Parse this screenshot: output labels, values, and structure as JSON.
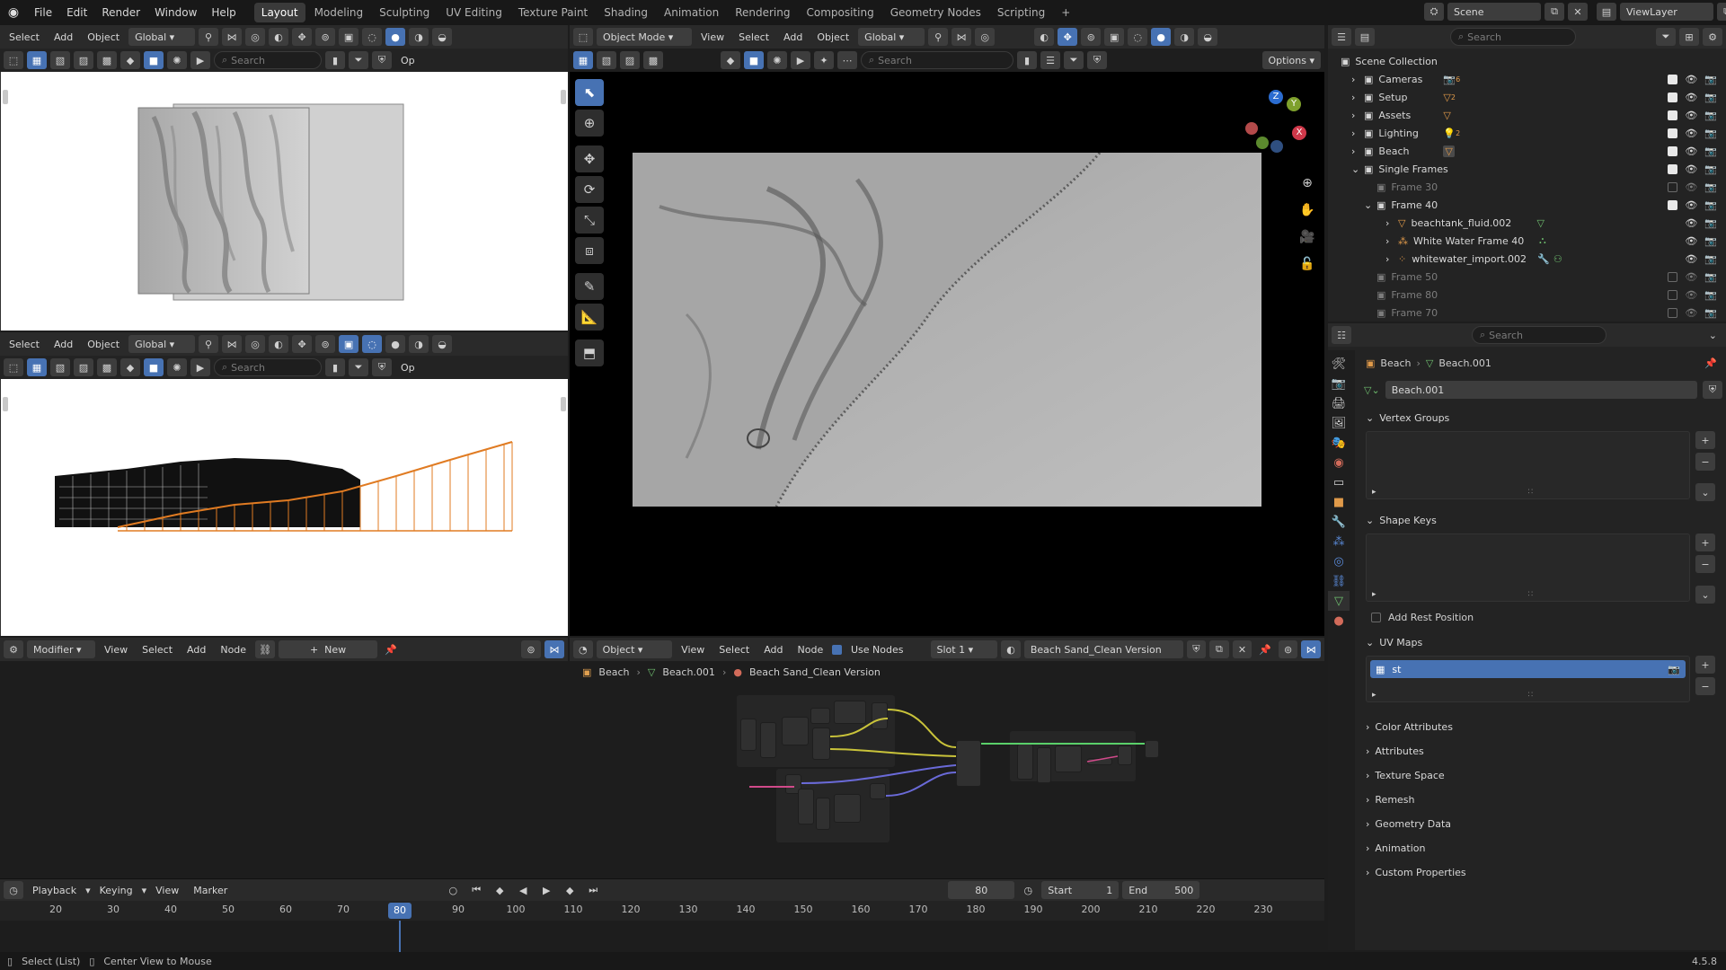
{
  "app": {
    "menus": [
      "File",
      "Edit",
      "Render",
      "Window",
      "Help"
    ],
    "workspaces": [
      "Layout",
      "Modeling",
      "Sculpting",
      "UV Editing",
      "Texture Paint",
      "Shading",
      "Animation",
      "Rendering",
      "Compositing",
      "Geometry Nodes",
      "Scripting"
    ],
    "active_workspace": "Layout",
    "scene_name": "Scene",
    "view_layer": "ViewLayer",
    "version": "4.5.8"
  },
  "viewports": {
    "left_header": {
      "select": "Select",
      "add": "Add",
      "object": "Object",
      "orientation": "Global",
      "search_placeholder": "Search",
      "options_short": "Op"
    },
    "main_header": {
      "mode": "Object Mode",
      "view": "View",
      "select": "Select",
      "add": "Add",
      "object": "Object",
      "orientation": "Global",
      "search_placeholder": "Search",
      "options": "Options"
    },
    "gizmo": {
      "z": "Z",
      "y": "Y",
      "x": "X"
    }
  },
  "modifier_editor": {
    "type": "Modifier",
    "menus": [
      "View",
      "Select",
      "Add",
      "Node"
    ],
    "new_label": "New"
  },
  "shader_editor": {
    "type": "Object",
    "menus": [
      "View",
      "Select",
      "Add",
      "Node"
    ],
    "use_nodes": "Use Nodes",
    "slot": "Slot 1",
    "material": "Beach Sand_Clean Version",
    "breadcrumb": [
      "Beach",
      "Beach.001",
      "Beach Sand_Clean Version"
    ]
  },
  "timeline": {
    "menus": [
      "Playback",
      "Keying",
      "View",
      "Marker"
    ],
    "current_frame": "80",
    "start_label": "Start",
    "start": "1",
    "end_label": "End",
    "end": "500",
    "ticks": [
      "20",
      "30",
      "40",
      "50",
      "60",
      "70",
      "80",
      "90",
      "100",
      "110",
      "120",
      "130",
      "140",
      "150",
      "160",
      "170",
      "180",
      "190",
      "200",
      "210",
      "220",
      "230"
    ]
  },
  "statusbar": {
    "left": "Select (List)",
    "middle": "Center View to Mouse"
  },
  "outliner": {
    "search_placeholder": "Search",
    "root": "Scene Collection",
    "items": [
      {
        "label": "Cameras",
        "badge": "6"
      },
      {
        "label": "Setup",
        "badge": "2"
      },
      {
        "label": "Assets",
        "badge": ""
      },
      {
        "label": "Lighting",
        "badge": "2"
      },
      {
        "label": "Beach",
        "badge": ""
      },
      {
        "label": "Single Frames",
        "badge": ""
      }
    ],
    "frames": {
      "frame30": "Frame 30",
      "frame40": "Frame 40",
      "frame40_children": [
        "beachtank_fluid.002",
        "White Water Frame 40",
        "whitewater_import.002"
      ],
      "frame50": "Frame 50",
      "frame80": "Frame 80",
      "frame70": "Frame 70"
    }
  },
  "properties": {
    "search_placeholder": "Search",
    "breadcrumb_object": "Beach",
    "breadcrumb_data": "Beach.001",
    "mesh_name": "Beach.001",
    "vertex_groups": "Vertex Groups",
    "shape_keys": "Shape Keys",
    "add_rest_position": "Add Rest Position",
    "uv_maps": "UV Maps",
    "uv_map_item": "st",
    "collapsed_panels": [
      "Color Attributes",
      "Attributes",
      "Texture Space",
      "Remesh",
      "Geometry Data",
      "Animation",
      "Custom Properties"
    ]
  },
  "colors": {
    "accent": "#4772b3",
    "header": "#2a2a2a",
    "bg": "#1d1d1d",
    "playhead": "#4772b3"
  }
}
